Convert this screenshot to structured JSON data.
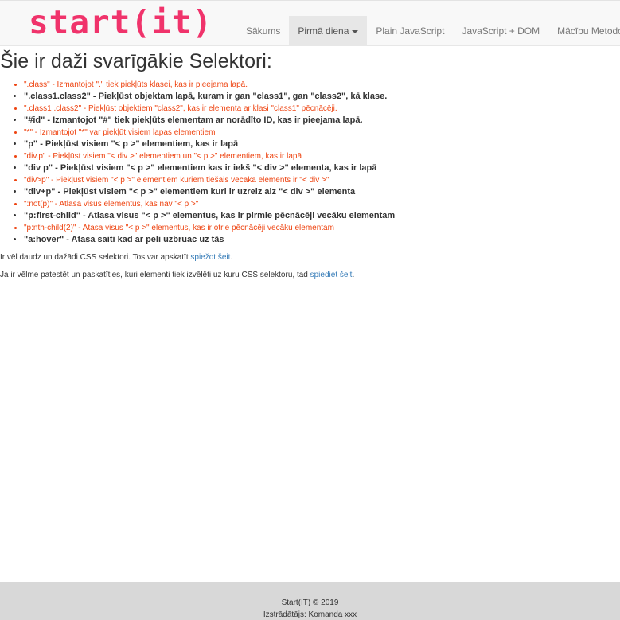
{
  "brand": {
    "logo_text": "start(it)",
    "color": "#f0336b"
  },
  "nav": {
    "items": [
      {
        "label": "Sākums",
        "active": false
      },
      {
        "label": "Pirmā diena",
        "active": true,
        "dropdown": true
      },
      {
        "label": "Plain JavaScript",
        "active": false
      },
      {
        "label": "JavaScript + DOM",
        "active": false
      },
      {
        "label": "Mācību Metodoloģija",
        "active": false
      }
    ]
  },
  "main": {
    "heading": "Šie ir daži svarīgākie Selektori:",
    "selectors": [
      {
        "text": "\".class\" - Izmantojot \".\" tiek piekļūts klasei, kas ir pieejama lapā.",
        "style": "orange"
      },
      {
        "text": "\".class1.class2\" - Piekļūst objektam lapā, kuram ir gan \"class1\", gan \"class2\", kā klase.",
        "style": "bold"
      },
      {
        "text": "\".class1 .class2\" - Piekļūst objektiem \"class2\", kas ir elementa ar klasi \"class1\" pēcnācēji.",
        "style": "orange"
      },
      {
        "text": "\"#id\" - Izmantojot \"#\" tiek piekļūts elementam ar norādīto ID, kas ir pieejama lapā.",
        "style": "bold"
      },
      {
        "text": "\"*\" - Izmantojot \"*\" var piekļūt visiem lapas elementiem",
        "style": "orange"
      },
      {
        "text": "\"p\" - Piekļūst visiem \"< p >\" elementiem, kas ir lapā",
        "style": "bold"
      },
      {
        "text": "\"div.p\" - Piekļūst visiem \"< div >\" elementiem un \"< p >\" elementiem, kas ir lapā",
        "style": "orange"
      },
      {
        "text": "\"div p\" - Piekļūst visiem \"< p >\" elementiem kas ir iekš \"< div >\" elementa, kas ir lapā",
        "style": "bold"
      },
      {
        "text": "\"div>p\" - Piekļūst visiem \"< p >\" elementiem kuriem tiešais vecāka elements ir \"< div >\"",
        "style": "orange"
      },
      {
        "text": "\"div+p\" - Piekļūst visiem \"< p >\" elementiem kuri ir uzreiz aiz \"< div >\" elementa",
        "style": "bold"
      },
      {
        "text": "\":not(p)\" - Atlasa visus elementus, kas nav \"< p >\"",
        "style": "orange"
      },
      {
        "text": "\"p:first-child\" - Atlasa visus \"< p >\" elementus, kas ir pirmie pēcnācēji vecāku elementam",
        "style": "bold"
      },
      {
        "text": "\"p:nth-child(2)\" - Atasa visus \"< p >\" elementus, kas ir otrie pēcnācēji vecāku elementam",
        "style": "orange"
      },
      {
        "text": "\"a:hover\" - Atasa saiti kad ar peli uzbruac uz tās",
        "style": "bold"
      }
    ],
    "para1": {
      "text": "Ir vēl daudz un dažādi CSS selektori. Tos var apskatīt ",
      "link_text": "spiežot šeit",
      "suffix": "."
    },
    "para2": {
      "text": "Ja ir vēlme patestēt un paskatīties, kuri elementi tiek izvēlēti uz kuru CSS selektoru, tad ",
      "link_text": "spiediet šeit",
      "suffix": "."
    }
  },
  "footer": {
    "line1": "Start(IT) © 2019",
    "line2": "Izstrādātājs: Komanda xxx"
  }
}
